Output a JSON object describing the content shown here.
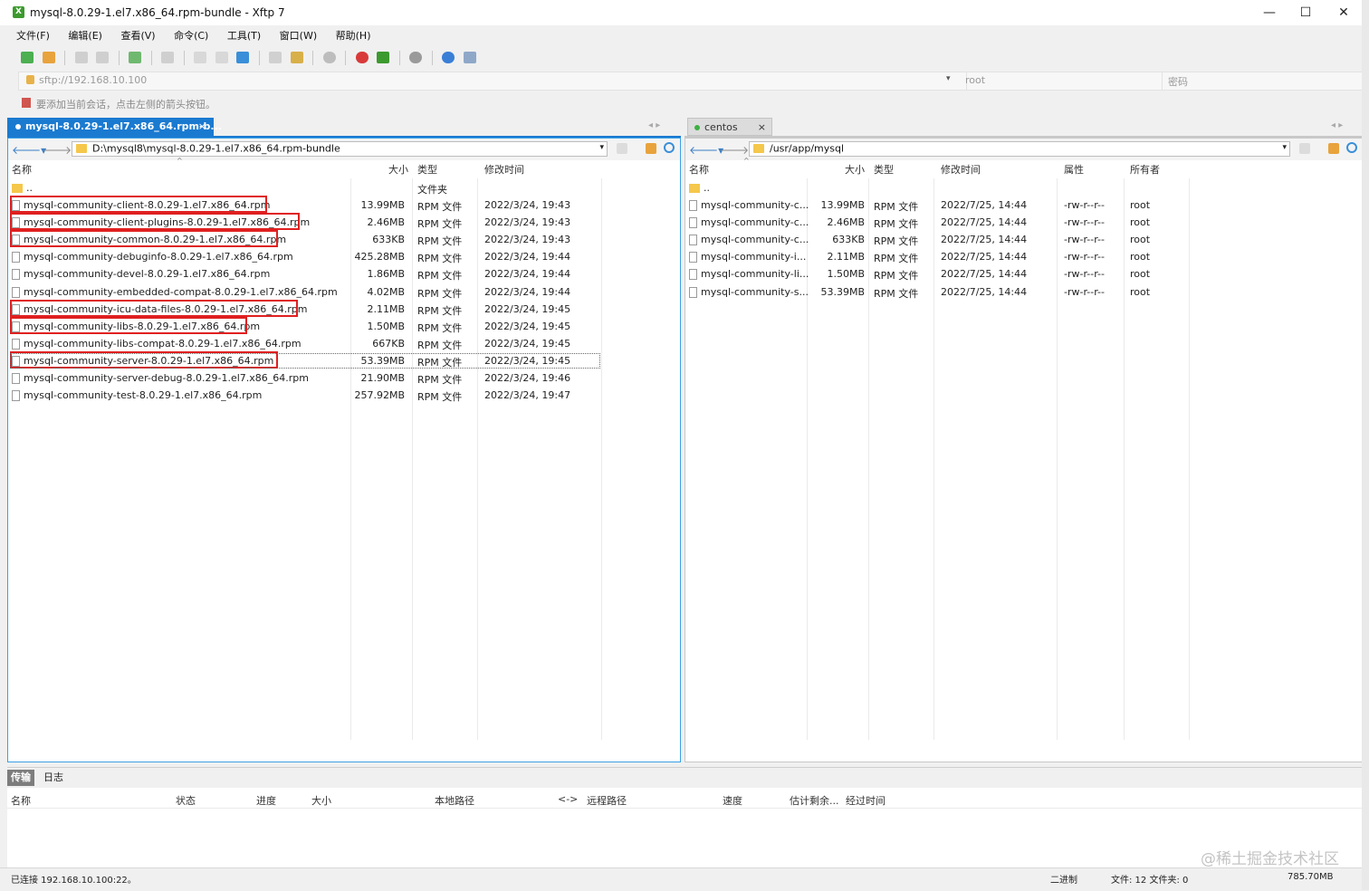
{
  "window": {
    "title": "mysql-8.0.29-1.el7.x86_64.rpm-bundle - Xftp 7",
    "app_icon": "xftp-icon",
    "minimize": "—",
    "maximize": "☐",
    "close": "✕"
  },
  "menu": [
    "文件(F)",
    "编辑(E)",
    "查看(V)",
    "命令(C)",
    "工具(T)",
    "窗口(W)",
    "帮助(H)"
  ],
  "address": {
    "url": "sftp://192.168.10.100",
    "user": "root",
    "password_placeholder": "密码"
  },
  "hint": "要添加当前会话，点击左侧的箭头按钮。",
  "tabs": {
    "local": "mysql-8.0.29-1.el7.x86_64.rpm-b...",
    "local_close": "×",
    "remote": "centos",
    "remote_close": "×"
  },
  "left": {
    "path": "D:\\mysql8\\mysql-8.0.29-1.el7.x86_64.rpm-bundle",
    "headers": {
      "name": "名称",
      "size": "大小",
      "type": "类型",
      "mtime": "修改时间"
    },
    "parent": {
      "name": "..",
      "type": "文件夹"
    },
    "rows": [
      {
        "name": "mysql-community-client-8.0.29-1.el7.x86_64.rpm",
        "size": "13.99MB",
        "type": "RPM 文件",
        "mtime": "2022/3/24, 19:43"
      },
      {
        "name": "mysql-community-client-plugins-8.0.29-1.el7.x86_64.rpm",
        "size": "2.46MB",
        "type": "RPM 文件",
        "mtime": "2022/3/24, 19:43"
      },
      {
        "name": "mysql-community-common-8.0.29-1.el7.x86_64.rpm",
        "size": "633KB",
        "type": "RPM 文件",
        "mtime": "2022/3/24, 19:43"
      },
      {
        "name": "mysql-community-debuginfo-8.0.29-1.el7.x86_64.rpm",
        "size": "425.28MB",
        "type": "RPM 文件",
        "mtime": "2022/3/24, 19:44"
      },
      {
        "name": "mysql-community-devel-8.0.29-1.el7.x86_64.rpm",
        "size": "1.86MB",
        "type": "RPM 文件",
        "mtime": "2022/3/24, 19:44"
      },
      {
        "name": "mysql-community-embedded-compat-8.0.29-1.el7.x86_64.rpm",
        "size": "4.02MB",
        "type": "RPM 文件",
        "mtime": "2022/3/24, 19:44"
      },
      {
        "name": "mysql-community-icu-data-files-8.0.29-1.el7.x86_64.rpm",
        "size": "2.11MB",
        "type": "RPM 文件",
        "mtime": "2022/3/24, 19:45"
      },
      {
        "name": "mysql-community-libs-8.0.29-1.el7.x86_64.rpm",
        "size": "1.50MB",
        "type": "RPM 文件",
        "mtime": "2022/3/24, 19:45"
      },
      {
        "name": "mysql-community-libs-compat-8.0.29-1.el7.x86_64.rpm",
        "size": "667KB",
        "type": "RPM 文件",
        "mtime": "2022/3/24, 19:45"
      },
      {
        "name": "mysql-community-server-8.0.29-1.el7.x86_64.rpm",
        "size": "53.39MB",
        "type": "RPM 文件",
        "mtime": "2022/3/24, 19:45"
      },
      {
        "name": "mysql-community-server-debug-8.0.29-1.el7.x86_64.rpm",
        "size": "21.90MB",
        "type": "RPM 文件",
        "mtime": "2022/3/24, 19:46"
      },
      {
        "name": "mysql-community-test-8.0.29-1.el7.x86_64.rpm",
        "size": "257.92MB",
        "type": "RPM 文件",
        "mtime": "2022/3/24, 19:47"
      }
    ]
  },
  "right": {
    "path": "/usr/app/mysql",
    "headers": {
      "name": "名称",
      "size": "大小",
      "type": "类型",
      "mtime": "修改时间",
      "attr": "属性",
      "owner": "所有者"
    },
    "parent": {
      "name": ".."
    },
    "rows": [
      {
        "name": "mysql-community-c...",
        "size": "13.99MB",
        "type": "RPM 文件",
        "mtime": "2022/7/25, 14:44",
        "attr": "-rw-r--r--",
        "owner": "root"
      },
      {
        "name": "mysql-community-c...",
        "size": "2.46MB",
        "type": "RPM 文件",
        "mtime": "2022/7/25, 14:44",
        "attr": "-rw-r--r--",
        "owner": "root"
      },
      {
        "name": "mysql-community-c...",
        "size": "633KB",
        "type": "RPM 文件",
        "mtime": "2022/7/25, 14:44",
        "attr": "-rw-r--r--",
        "owner": "root"
      },
      {
        "name": "mysql-community-i...",
        "size": "2.11MB",
        "type": "RPM 文件",
        "mtime": "2022/7/25, 14:44",
        "attr": "-rw-r--r--",
        "owner": "root"
      },
      {
        "name": "mysql-community-li...",
        "size": "1.50MB",
        "type": "RPM 文件",
        "mtime": "2022/7/25, 14:44",
        "attr": "-rw-r--r--",
        "owner": "root"
      },
      {
        "name": "mysql-community-s...",
        "size": "53.39MB",
        "type": "RPM 文件",
        "mtime": "2022/7/25, 14:44",
        "attr": "-rw-r--r--",
        "owner": "root"
      }
    ]
  },
  "transfer": {
    "tab_transfer": "传输",
    "tab_log": "日志",
    "headers": {
      "name": "名称",
      "status": "状态",
      "progress": "进度",
      "size": "大小",
      "local": "本地路径",
      "dir": "<->",
      "remote": "远程路径",
      "speed": "速度",
      "eta": "估计剩余...",
      "elapsed": "经过时间"
    }
  },
  "status": {
    "connected": "已连接 192.168.10.100:22。",
    "mode": "二进制",
    "counts": "文件: 12  文件夹: 0",
    "total": "785.70MB"
  },
  "watermark": "@稀土掘金技术社区",
  "colors": {
    "accent": "#1a7ad0",
    "highlight": "#e02020",
    "folder": "#f5c74a"
  }
}
